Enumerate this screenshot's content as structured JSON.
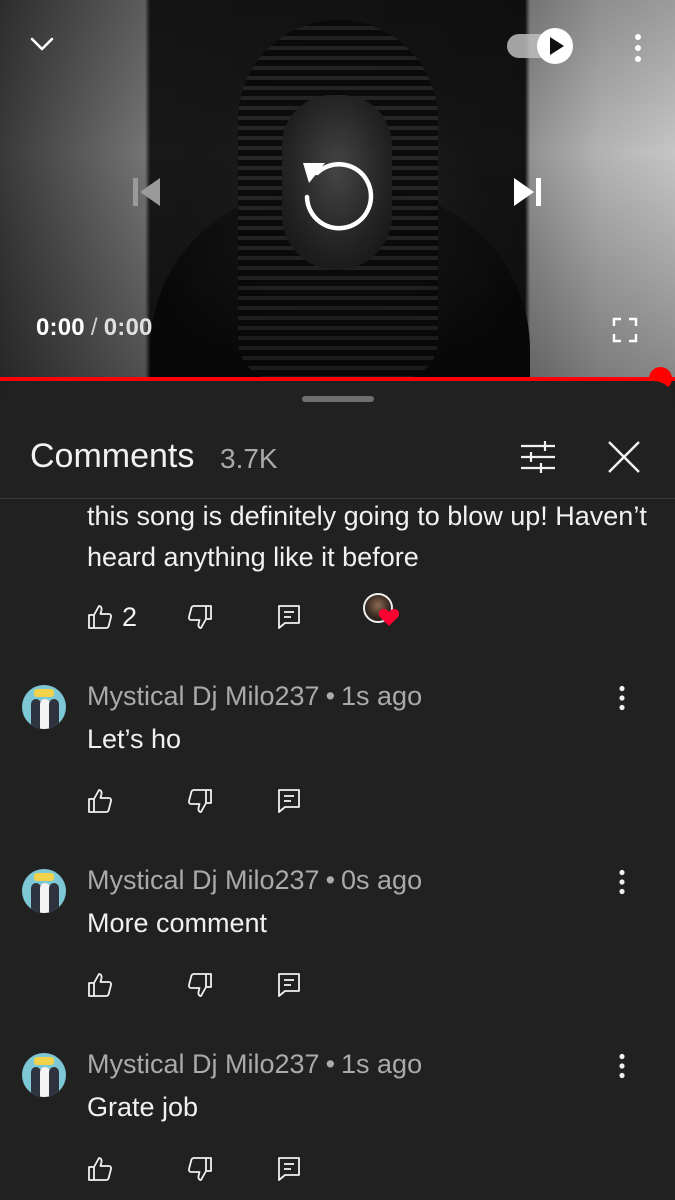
{
  "player": {
    "time_current": "0:00",
    "time_separator": "/",
    "time_duration": "0:00",
    "autoplay": true,
    "progress": 1.0,
    "accent_color": "#ff0000",
    "icons": [
      "chevron-down-icon",
      "autoplay-toggle-icon",
      "more-vert-icon",
      "skip-previous-icon",
      "replay-icon",
      "skip-next-icon",
      "fullscreen-icon"
    ]
  },
  "comments_panel": {
    "title": "Comments",
    "count": "3.7K",
    "icons": [
      "sort-filter-icon",
      "close-icon"
    ]
  },
  "first_comment": {
    "text": "this song is definitely going to blow up! Haven’t heard anything like it before",
    "like_count": "2",
    "creator_heart": true
  },
  "comments": [
    {
      "author": "Mystical Dj Milo237",
      "separator": "•",
      "time": "1s ago",
      "text": "Let’s ho"
    },
    {
      "author": "Mystical Dj Milo237",
      "separator": "•",
      "time": "0s ago",
      "text": "More comment"
    },
    {
      "author": "Mystical Dj Milo237",
      "separator": "•",
      "time": "1s ago",
      "text": "Grate job"
    }
  ]
}
